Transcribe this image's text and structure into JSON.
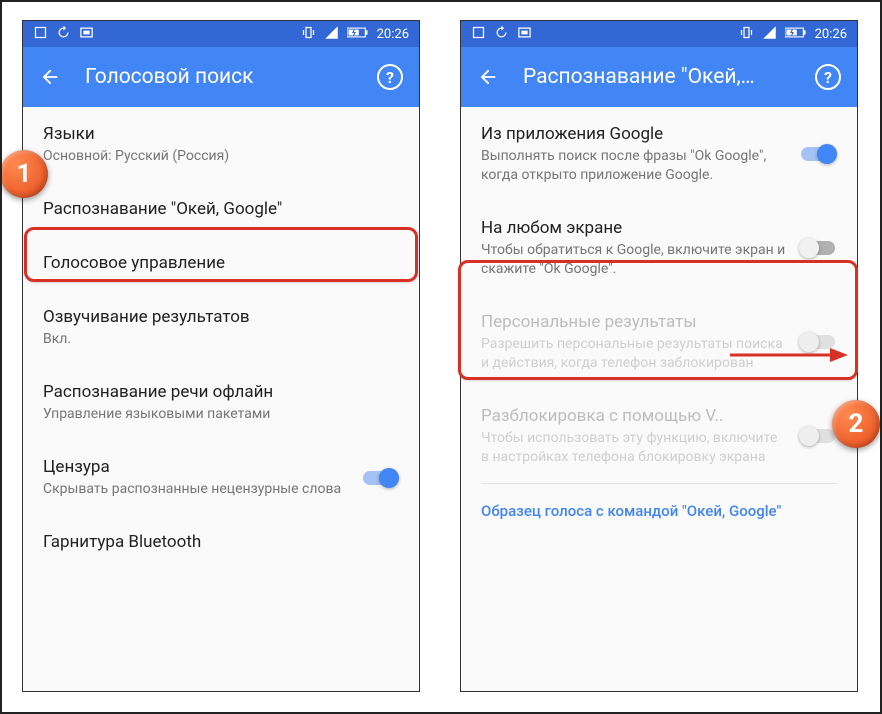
{
  "status": {
    "time": "20:26"
  },
  "left": {
    "title": "Голосовой поиск",
    "items": {
      "languages": {
        "title": "Языки",
        "sub": "Основной: Русский (Россия)"
      },
      "ok_google": {
        "title": "Распознавание \"Окей, Google\""
      },
      "voice_ctrl": {
        "title": "Голосовое управление"
      },
      "tts": {
        "title": "Озвучивание результатов",
        "sub": "Вкл."
      },
      "offline": {
        "title": "Распознавание речи офлайн",
        "sub": "Управление языковыми пакетами"
      },
      "censor": {
        "title": "Цензура",
        "sub": "Скрывать распознанные нецензурные слова"
      },
      "bluetooth": {
        "title": "Гарнитура Bluetooth"
      }
    }
  },
  "right": {
    "title": "Распознавание \"Окей,…",
    "items": {
      "from_app": {
        "title": "Из приложения Google",
        "sub": "Выполнять поиск после фразы \"Ok Google\", когда открыто приложение Google."
      },
      "any_screen": {
        "title": "На любом экране",
        "sub": "Чтобы обратиться к Google, включите экран и скажите \"Ok Google\"."
      },
      "personal": {
        "title": "Персональные результаты",
        "sub": "Разрешить персональные результаты поиска и действия, когда телефон заблокирован"
      },
      "unlock": {
        "title": "Разблокировка с помощью V..",
        "sub": "Чтобы использовать эту функцию, включите в настройках телефона блокировку экрана"
      }
    },
    "link": "Образец голоса с командой \"Окей, Google\""
  },
  "callouts": {
    "one": "1",
    "two": "2"
  }
}
